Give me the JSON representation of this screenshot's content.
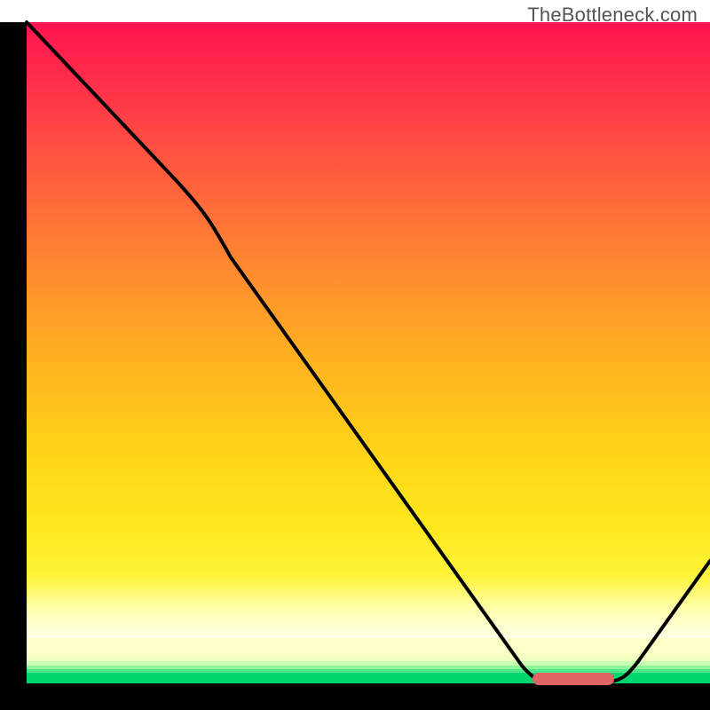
{
  "attribution": "TheBottleneck.com",
  "chart_data": {
    "type": "line",
    "title": "",
    "xlabel": "",
    "ylabel": "",
    "xlim": [
      0,
      100
    ],
    "ylim": [
      0,
      100
    ],
    "background_gradient": {
      "orientation": "vertical",
      "stops": [
        {
          "pos": 0.0,
          "color": "#ff1450"
        },
        {
          "pos": 0.25,
          "color": "#ff5d3e"
        },
        {
          "pos": 0.55,
          "color": "#ffb220"
        },
        {
          "pos": 0.82,
          "color": "#ffe81e"
        },
        {
          "pos": 0.95,
          "color": "#ffffaa"
        },
        {
          "pos": 0.985,
          "color": "#4fe68a"
        },
        {
          "pos": 1.0,
          "color": "#00d66e"
        }
      ]
    },
    "series": [
      {
        "name": "bottleneck-curve",
        "color": "#000000",
        "x": [
          0,
          10,
          22,
          30,
          40,
          50,
          60,
          68,
          74,
          78,
          82,
          86,
          90,
          100
        ],
        "y": [
          100,
          88,
          76,
          64,
          52,
          38,
          24,
          12,
          3,
          0,
          0,
          0,
          3,
          18
        ]
      }
    ],
    "marker": {
      "name": "optimal-range",
      "x_start": 74,
      "x_end": 86,
      "y": 0,
      "color": "#e06666"
    }
  }
}
